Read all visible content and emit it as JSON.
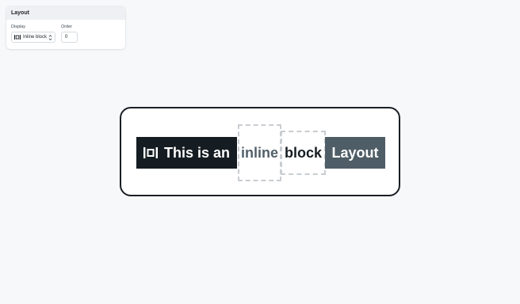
{
  "panel": {
    "title": "Layout",
    "display_label": "Display",
    "display_value": "Inline block",
    "order_label": "Order",
    "order_value": "0"
  },
  "preview": {
    "items": [
      "This is an",
      "inline",
      "block",
      "Layout"
    ]
  },
  "colors": {
    "background": "#f7f8fa",
    "dark_chip": "#161d22",
    "slate_chip": "#4e5d66",
    "muted_text": "#526069",
    "dashed_border": "#c9cdd1"
  },
  "icons": {
    "display": "inline-block-icon",
    "select": "chevron-up-down-icon"
  }
}
